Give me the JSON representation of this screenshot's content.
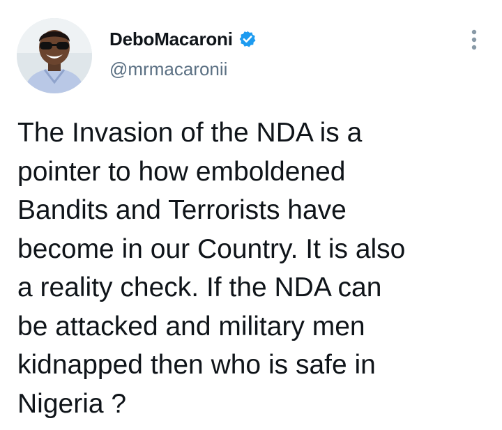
{
  "author": {
    "display_name": "DeboMacaroni",
    "handle": "@mrmacaronii",
    "verified": true,
    "avatar_icon": "profile-photo"
  },
  "menu": {
    "icon": "more-vertical-icon"
  },
  "tweet": {
    "text": "The Invasion of the NDA is a\npointer to how emboldened\nBandits and Terrorists have\nbecome in our Country. It is also\na reality check. If the NDA can\nbe attacked and military men\nkidnapped then who is safe in\nNigeria ?"
  },
  "colors": {
    "verified_badge": "#1d9bf0",
    "handle": "#5b7083",
    "text": "#0f1419",
    "menu_dots": "#8899a6"
  }
}
